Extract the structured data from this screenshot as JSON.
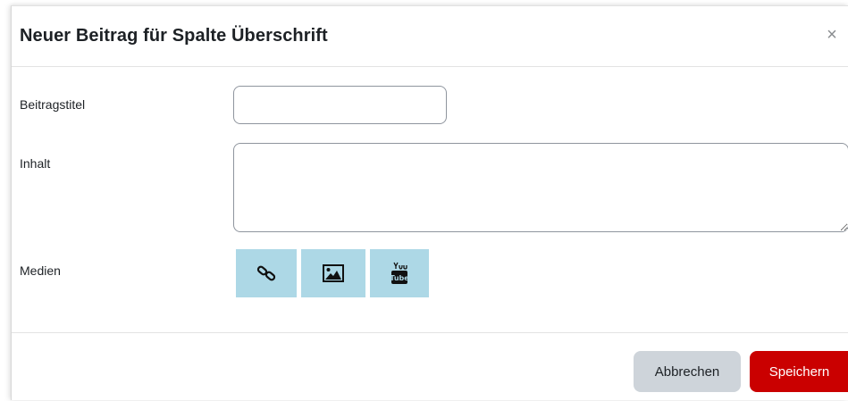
{
  "dialog": {
    "title": "Neuer Beitrag für Spalte Überschrift",
    "close_symbol": "×"
  },
  "form": {
    "title_label": "Beitragstitel",
    "title_value": "",
    "content_label": "Inhalt",
    "content_value": "",
    "media_label": "Medien",
    "media_buttons": [
      {
        "icon": "link-icon"
      },
      {
        "icon": "image-icon"
      },
      {
        "icon": "youtube-icon"
      }
    ]
  },
  "footer": {
    "cancel_label": "Abbrechen",
    "save_label": "Speichern"
  },
  "colors": {
    "media_button_bg": "#add8e6",
    "save_button_bg": "#ca0000",
    "cancel_button_bg": "#ced4da"
  }
}
